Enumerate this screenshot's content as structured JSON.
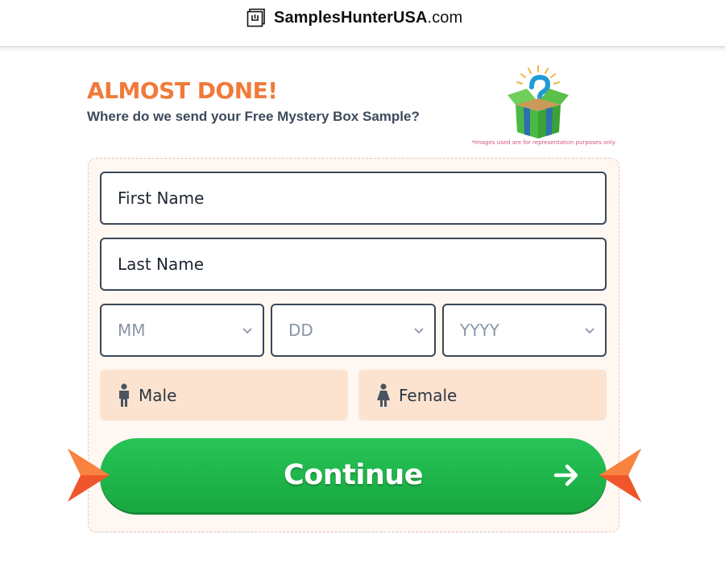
{
  "header": {
    "brand_bold": "SamplesHunterUSA",
    "brand_suffix": ".com",
    "logo_icon": "box-logo-icon"
  },
  "hero": {
    "headline": "ALMOST DONE!",
    "subhead": "Where do we send your Free Mystery Box Sample?",
    "disclaimer": "*Images used are for representation purposes only.",
    "image": "mystery-gift-box"
  },
  "form": {
    "first_name_placeholder": "First Name",
    "last_name_placeholder": "Last Name",
    "dob": {
      "month": "MM",
      "day": "DD",
      "year": "YYYY"
    },
    "gender": {
      "male": "Male",
      "female": "Female"
    },
    "continue_label": "Continue"
  },
  "colors": {
    "accent_orange": "#f07a3a",
    "continue_green": "#22b54b",
    "field_border": "#3b4756",
    "gender_bg": "#fbe3cf"
  }
}
